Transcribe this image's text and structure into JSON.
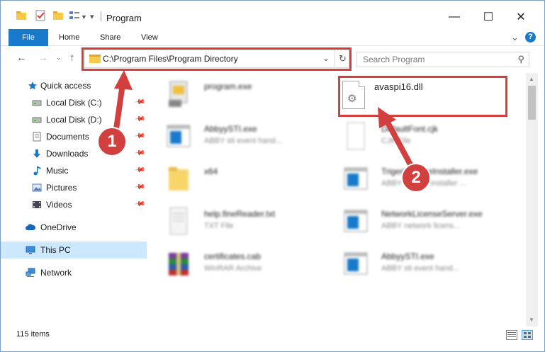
{
  "window": {
    "title": "Program"
  },
  "title_controls": {
    "minimize": "—",
    "maximize": "☐",
    "close": "✕"
  },
  "ribbon": {
    "tabs": [
      {
        "label": "File"
      },
      {
        "label": "Home"
      },
      {
        "label": "Share"
      },
      {
        "label": "View"
      }
    ],
    "help_label": "?"
  },
  "nav": {
    "address": "C:\\Program Files\\Program Directory",
    "search_placeholder": "Search Program"
  },
  "sidebar": {
    "items": [
      {
        "label": "Quick access",
        "icon": "star-icon"
      },
      {
        "label": "Local Disk (C:)",
        "icon": "drive-icon"
      },
      {
        "label": "Local Disk (D:)",
        "icon": "drive-icon"
      },
      {
        "label": "Documents",
        "icon": "documents-icon"
      },
      {
        "label": "Downloads",
        "icon": "download-icon"
      },
      {
        "label": "Music",
        "icon": "music-icon"
      },
      {
        "label": "Pictures",
        "icon": "pictures-icon"
      },
      {
        "label": "Videos",
        "icon": "videos-icon"
      },
      {
        "label": "OneDrive",
        "icon": "cloud-icon"
      },
      {
        "label": "This PC",
        "icon": "computer-icon"
      },
      {
        "label": "Network",
        "icon": "network-icon"
      }
    ]
  },
  "files": [
    {
      "name": "program.exe",
      "desc": ""
    },
    {
      "name": "AbbyySTI.exe",
      "desc": "ABBY sti event hand..."
    },
    {
      "name": "x64",
      "desc": ""
    },
    {
      "name": "help.fineReader.txt",
      "desc": "TXT File"
    },
    {
      "name": "certificates.cab",
      "desc": "WinRAR Archive"
    },
    {
      "name": "DefaultFont.cjk",
      "desc": "CJK File"
    },
    {
      "name": "TrigerLicenseInstaller.exe",
      "desc": "ABBY license installer ..."
    },
    {
      "name": "NetworkLicenseServer.exe",
      "desc": "ABBY network licens..."
    },
    {
      "name": "AbbyySTI.exe",
      "desc": "ABBY sti event hand..."
    }
  ],
  "highlighted_file": {
    "name": "avaspi16.dll"
  },
  "annotations": {
    "step1": "1",
    "step2": "2"
  },
  "status": {
    "item_count": "115 items"
  },
  "colors": {
    "accent": "#1979ca",
    "annotation": "#d23f3f",
    "selected": "#cce8ff"
  }
}
